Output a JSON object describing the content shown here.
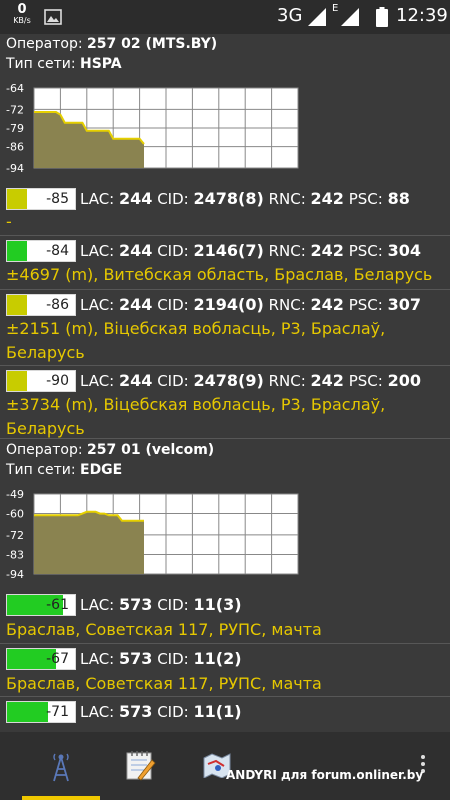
{
  "status_bar": {
    "speed_value": "0",
    "speed_unit": "KB/s",
    "network_type": "3G",
    "secondary_network": "E",
    "time": "12:39",
    "icons": [
      "image-icon",
      "signal-icon",
      "signal-icon",
      "battery-icon"
    ]
  },
  "operators": [
    {
      "operator_label": "Оператор:",
      "operator_name": "257 02 (MTS.BY)",
      "network_label": "Тип сети:",
      "network_type": "HSPA",
      "chart_data": {
        "type": "line",
        "y_tick_labels": [
          "-64",
          "-72",
          "-79",
          "-86",
          "-94"
        ],
        "ylim": [
          -94,
          -64
        ],
        "x": [
          0,
          1,
          2,
          3,
          4,
          5,
          6,
          7,
          8,
          9,
          10,
          11,
          12,
          13,
          14,
          15,
          16,
          17,
          18,
          19,
          20,
          21,
          22,
          23,
          24,
          25
        ],
        "values": [
          -73,
          -73,
          -73,
          -73,
          -73,
          -73,
          -74,
          -77,
          -77,
          -77,
          -77,
          -77,
          -80,
          -80,
          -80,
          -80,
          -80,
          -80,
          -83,
          -83,
          -83,
          -83,
          -83,
          -83,
          -83,
          -85
        ],
        "line_color": "#e6d000",
        "fill_color": "#8a8350",
        "grid": true
      }
    },
    {
      "operator_label": "Оператор:",
      "operator_name": "257 01 (velcom)",
      "network_label": "Тип сети:",
      "network_type": "EDGE",
      "chart_data": {
        "type": "line",
        "y_tick_labels": [
          "-49",
          "-60",
          "-72",
          "-83",
          "-94"
        ],
        "ylim": [
          -94,
          -49
        ],
        "x": [
          0,
          1,
          2,
          3,
          4,
          5,
          6,
          7,
          8,
          9,
          10,
          11,
          12,
          13,
          14,
          15,
          16,
          17,
          18,
          19,
          20,
          21,
          22,
          23,
          24,
          25
        ],
        "values": [
          -61,
          -61,
          -61,
          -61,
          -61,
          -61,
          -61,
          -61,
          -61,
          -61,
          -61,
          -60,
          -59,
          -59,
          -59,
          -60,
          -60,
          -61,
          -61,
          -61,
          -64,
          -64,
          -64,
          -64,
          -64,
          -64
        ],
        "line_color": "#e6d000",
        "fill_color": "#8a8350",
        "grid": true
      }
    }
  ],
  "cells_mts": [
    {
      "level": "-85",
      "bar_fraction": 0.3,
      "bar_color": "#c8cc00",
      "lac_label": "LAC:",
      "lac": "244",
      "cid_label": "CID:",
      "cid": "2478(8)",
      "rnc_label": "RNC:",
      "rnc": "242",
      "psc_label": "PSC:",
      "psc": "88",
      "location": "-"
    },
    {
      "level": "-84",
      "bar_fraction": 0.3,
      "bar_color": "#22cc22",
      "lac_label": "LAC:",
      "lac": "244",
      "cid_label": "CID:",
      "cid": "2146(7)",
      "rnc_label": "RNC:",
      "rnc": "242",
      "psc_label": "PSC:",
      "psc": "304",
      "location": "±4697 (m), Витебская область, Браслав, Беларусь"
    },
    {
      "level": "-86",
      "bar_fraction": 0.3,
      "bar_color": "#c8cc00",
      "lac_label": "LAC:",
      "lac": "244",
      "cid_label": "CID:",
      "cid": "2194(0)",
      "rnc_label": "RNC:",
      "rnc": "242",
      "psc_label": "PSC:",
      "psc": "307",
      "location": "±2151 (m), Віцебская вобласць, Р3, Браслаў, Беларусь"
    },
    {
      "level": "-90",
      "bar_fraction": 0.3,
      "bar_color": "#c8cc00",
      "lac_label": "LAC:",
      "lac": "244",
      "cid_label": "CID:",
      "cid": "2478(9)",
      "rnc_label": "RNC:",
      "rnc": "242",
      "psc_label": "PSC:",
      "psc": "200",
      "location": "±3734 (m), Віцебская вобласць, Р3, Браслаў, Беларусь"
    }
  ],
  "cells_velcom": [
    {
      "level": "-61",
      "bar_fraction": 0.82,
      "bar_color": "#22cc22",
      "lac_label": "LAC:",
      "lac": "573",
      "cid_label": "CID:",
      "cid": "11(3)",
      "location": "Браслав, Советская 117, РУПС, мачта"
    },
    {
      "level": "-67",
      "bar_fraction": 0.72,
      "bar_color": "#22cc22",
      "lac_label": "LAC:",
      "lac": "573",
      "cid_label": "CID:",
      "cid": "11(2)",
      "location": "Браслав, Советская 117, РУПС, мачта"
    },
    {
      "level": "-71",
      "bar_fraction": 0.6,
      "bar_color": "#22cc22",
      "lac_label": "LAC:",
      "lac": "573",
      "cid_label": "CID:",
      "cid": "11(1)",
      "location": ""
    }
  ],
  "bottom_nav": {
    "tabs": [
      "cell-tower-icon",
      "notepad-icon",
      "map-icon"
    ],
    "active_tab": 0,
    "watermark": "ANDYRI для forum.onliner.by"
  }
}
